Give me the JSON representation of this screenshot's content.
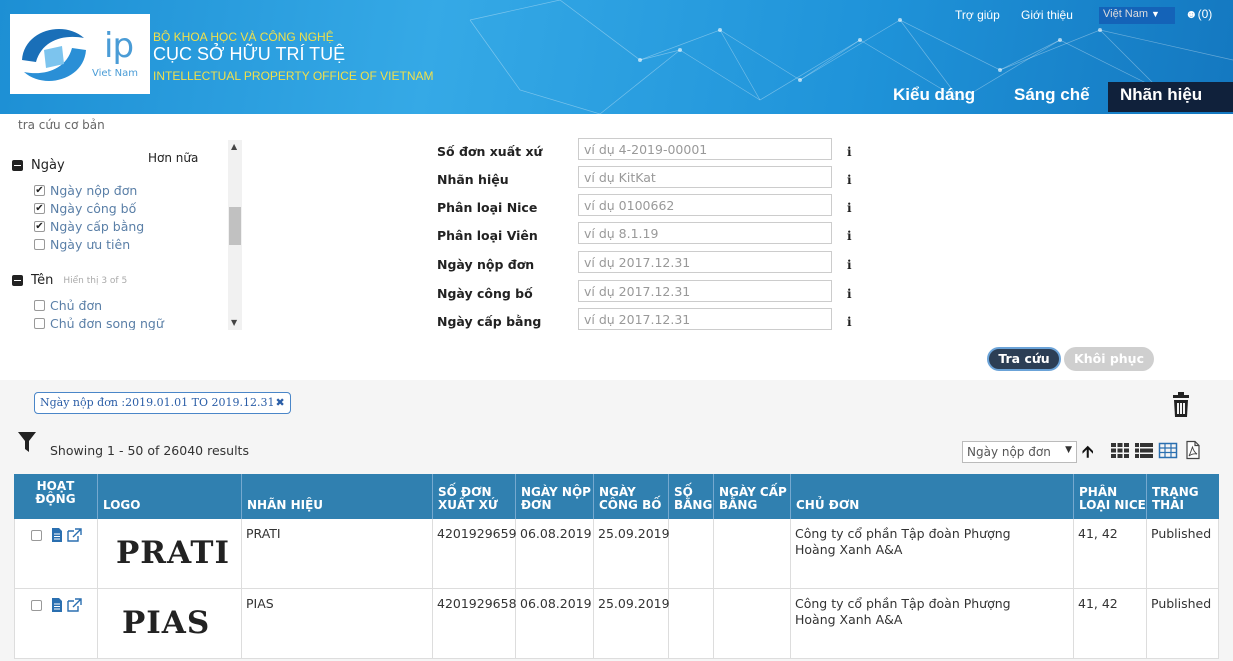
{
  "header": {
    "logo_ip": "ip",
    "logo_country": "Viet Nam",
    "ministry": "BỘ KHOA HỌC VÀ CÔNG NGHỆ",
    "office_vn": "CỤC SỞ HỮU TRÍ TUỆ",
    "office_en": "INTELLECTUAL PROPERTY OFFICE OF VIETNAM",
    "links": {
      "help": "Trợ giúp",
      "about": "Giới thiệu"
    },
    "language": "Việt Nam",
    "cart_count": "(0)",
    "nav": {
      "designs": "Kiểu dáng",
      "patents": "Sáng chế",
      "trademarks": "Nhãn hiệu"
    }
  },
  "breadcrumb": "tra cứu cơ bản",
  "filters": {
    "more_label": "Hơn nữa",
    "groups": [
      {
        "title": "Ngày",
        "hint": "",
        "items": [
          {
            "label": "Ngày nộp đơn",
            "checked": true
          },
          {
            "label": "Ngày công bố",
            "checked": true
          },
          {
            "label": "Ngày cấp bằng",
            "checked": true
          },
          {
            "label": "Ngày ưu tiên",
            "checked": false
          }
        ]
      },
      {
        "title": "Tên",
        "hint": "Hiển thị 3 of 5",
        "items": [
          {
            "label": "Chủ đơn",
            "checked": false
          },
          {
            "label": "Chủ đơn song ngữ",
            "checked": false
          }
        ]
      }
    ]
  },
  "form": {
    "fields": [
      {
        "label": "Số đơn xuất xứ",
        "placeholder": "ví dụ 4-2019-00001"
      },
      {
        "label": "Nhãn hiệu",
        "placeholder": "ví dụ KitKat"
      },
      {
        "label": "Phân loại Nice",
        "placeholder": "ví dụ 0100662"
      },
      {
        "label": "Phân loại Viên",
        "placeholder": "ví dụ 8.1.19"
      },
      {
        "label": "Ngày nộp đơn",
        "placeholder": "ví dụ 2017.12.31"
      },
      {
        "label": "Ngày công bố",
        "placeholder": "ví dụ 2017.12.31"
      },
      {
        "label": "Ngày cấp bằng",
        "placeholder": "ví dụ 2017.12.31"
      }
    ],
    "info_glyph": "i",
    "search_label": "Tra cứu",
    "reset_label": "Khôi phục"
  },
  "active_filter": "Ngày nộp đơn :2019.01.01 TO 2019.12.31",
  "results": {
    "summary": "Showing 1 - 50 of 26040 results",
    "sort_by": "Ngày nộp đơn"
  },
  "table": {
    "headers": {
      "actions": [
        "HOẠT",
        "ĐỘNG"
      ],
      "logo": "LOGO",
      "mark": "NHÃN HIỆU",
      "app_no": [
        "SỐ ĐƠN",
        "XUẤT XỨ"
      ],
      "filing_date": [
        "NGÀY NỘP",
        "ĐƠN"
      ],
      "pub_date": [
        "NGÀY",
        "CÔNG BỐ"
      ],
      "reg_no": [
        "SỐ",
        "BẰNG"
      ],
      "grant_date": [
        "NGÀY CẤP",
        "BẰNG"
      ],
      "owner": "CHỦ ĐƠN",
      "nice": [
        "PHÂN",
        "LOẠI NICE"
      ],
      "status": [
        "TRẠNG",
        "THÁI"
      ]
    },
    "rows": [
      {
        "logo": "PRATI",
        "mark": "PRATI",
        "app_no": "4201929659",
        "filing_date": "06.08.2019",
        "pub_date": "25.09.2019",
        "reg_no": "",
        "grant_date": "",
        "owner": "Công ty cổ phần Tập đoàn Phượng Hoàng Xanh A&A",
        "nice": "41, 42",
        "status": "Published"
      },
      {
        "logo": "PIAS",
        "mark": "PIAS",
        "app_no": "4201929658",
        "filing_date": "06.08.2019",
        "pub_date": "25.09.2019",
        "reg_no": "",
        "grant_date": "",
        "owner": "Công ty cổ phần Tập đoàn Phượng Hoàng Xanh A&A",
        "nice": "41, 42",
        "status": "Published"
      }
    ]
  },
  "colors": {
    "header_blue": "#2a9be0",
    "table_head": "#3080b0",
    "active_tab": "#10213b",
    "search_button": "#2c3e55"
  }
}
